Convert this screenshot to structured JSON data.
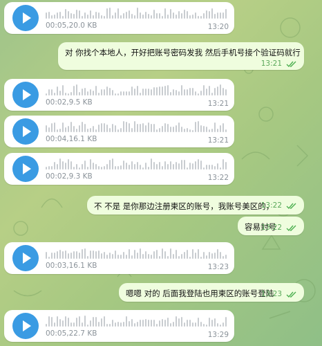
{
  "colors": {
    "accent": "#3a9be3",
    "outgoing_bubble": "#effdde",
    "incoming_bubble": "#ffffff",
    "read_check": "#4caf50"
  },
  "messages": [
    {
      "type": "voice",
      "meta": "00:05,20.0 KB",
      "time": "13:20"
    },
    {
      "type": "text",
      "text": "对  你找个本地人，开好把账号密码发我  然后手机号接个验证码就行",
      "time": "13:21",
      "status": "read-icon"
    },
    {
      "type": "voice",
      "meta": "00:02,9.5 KB",
      "time": "13:21"
    },
    {
      "type": "voice",
      "meta": "00:04,16.1 KB",
      "time": "13:21"
    },
    {
      "type": "voice",
      "meta": "00:02,9.3 KB",
      "time": "13:22"
    },
    {
      "type": "text",
      "text": "不  不是  是你那边注册柬区的账号，我账号美区的，",
      "time": "13:22",
      "status": "read-icon"
    },
    {
      "type": "text",
      "text": "容易封号",
      "time": "13:22",
      "status": "read-icon"
    },
    {
      "type": "voice",
      "meta": "00:03,16.1 KB",
      "time": "13:23"
    },
    {
      "type": "text",
      "text": "嗯嗯  对的  后面我登陆也用柬区的账号登陆",
      "time": "13:23",
      "status": "read-icon"
    },
    {
      "type": "voice",
      "meta": "00:05,22.7 KB",
      "time": "13:29"
    }
  ]
}
